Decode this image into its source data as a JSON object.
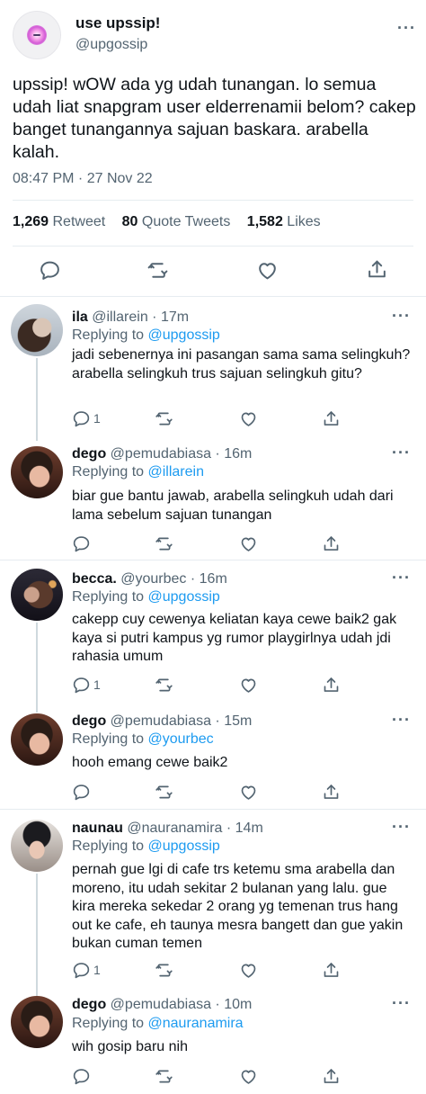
{
  "main_tweet": {
    "name": "use upssip!",
    "handle": "@upgossip",
    "text": "upssip! wOW ada yg udah tunangan. lo semua udah liat snapgram user elderrenamii belom? cakep banget tunangannya sajuan baskara. arabella kalah.",
    "timestamp": "08:47 PM · 27 Nov 22",
    "stats": {
      "retweets_count": "1,269",
      "retweets_label": "Retweet",
      "quotes_count": "80",
      "quotes_label": "Quote Tweets",
      "likes_count": "1,582",
      "likes_label": "Likes"
    },
    "icons": [
      "reply-icon",
      "retweet-icon",
      "like-icon",
      "share-icon"
    ]
  },
  "replying_label": "Replying to",
  "replies": [
    {
      "name": "ila",
      "handle": "@illarein",
      "time": "17m",
      "replying_to": "@upgossip",
      "text": "jadi sebenernya ini pasangan sama sama selingkuh? arabella selingkuh trus sajuan selingkuh gitu?",
      "reply_count": "1"
    },
    {
      "name": "dego",
      "handle": "@pemudabiasa",
      "time": "16m",
      "replying_to": "@illarein",
      "text": "biar gue bantu jawab, arabella selingkuh udah dari lama sebelum sajuan tunangan",
      "reply_count": ""
    },
    {
      "name": "becca.",
      "handle": "@yourbec",
      "time": "16m",
      "replying_to": "@upgossip",
      "text": "cakepp cuy cewenya keliatan kaya cewe baik2 gak kaya si putri kampus yg rumor playgirlnya udah jdi rahasia umum",
      "reply_count": "1"
    },
    {
      "name": "dego",
      "handle": "@pemudabiasa",
      "time": "15m",
      "replying_to": "@yourbec",
      "text": "hooh emang cewe baik2",
      "reply_count": ""
    },
    {
      "name": "naunau",
      "handle": "@nauranamira",
      "time": "14m",
      "replying_to": "@upgossip",
      "text": "pernah gue lgi di cafe trs ketemu sma arabella dan moreno, itu udah sekitar 2 bulanan yang lalu. gue kira mereka sekedar 2 orang yg temenan trus hang out ke cafe, eh taunya mesra bangett dan gue yakin bukan cuman temen",
      "reply_count": "1"
    },
    {
      "name": "dego",
      "handle": "@pemudabiasa",
      "time": "10m",
      "replying_to": "@nauranamira",
      "text": "wih gosip baru nih",
      "reply_count": ""
    }
  ],
  "colors": {
    "link": "#1d9bf0",
    "secondary_text": "#536471",
    "divider": "#e6ecf0",
    "thread_line": "#cfd9de"
  }
}
